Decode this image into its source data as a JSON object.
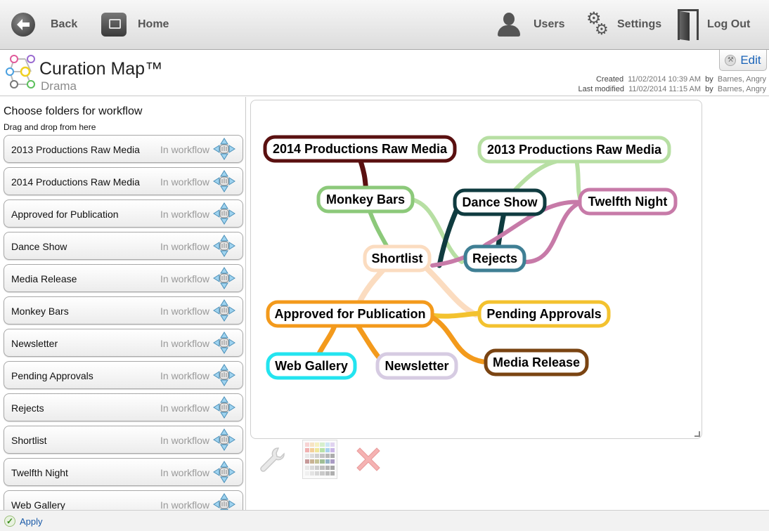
{
  "toolbar": {
    "back_label": "Back",
    "home_label": "Home",
    "users_label": "Users",
    "settings_label": "Settings",
    "logout_label": "Log Out"
  },
  "header": {
    "title": "Curation Map™",
    "subtitle": "Drama",
    "edit_label": "Edit",
    "created_label": "Created",
    "created_date": "11/02/2014 10:39 AM",
    "created_by_label": "by",
    "created_by": "Barnes, Angry",
    "modified_label": "Last modified",
    "modified_date": "11/02/2014 11:15 AM",
    "modified_by_label": "by",
    "modified_by": "Barnes, Angry"
  },
  "sidebar": {
    "heading": "Choose folders for workflow",
    "hint": "Drag and drop from here",
    "items": [
      {
        "name": "2013 Productions Raw Media",
        "status": "In workflow"
      },
      {
        "name": "2014 Productions Raw Media",
        "status": "In workflow"
      },
      {
        "name": "Approved for Publication",
        "status": "In workflow"
      },
      {
        "name": "Dance Show",
        "status": "In workflow"
      },
      {
        "name": "Media Release",
        "status": "In workflow"
      },
      {
        "name": "Monkey Bars",
        "status": "In workflow"
      },
      {
        "name": "Newsletter",
        "status": "In workflow"
      },
      {
        "name": "Pending Approvals",
        "status": "In workflow"
      },
      {
        "name": "Rejects",
        "status": "In workflow"
      },
      {
        "name": "Shortlist",
        "status": "In workflow"
      },
      {
        "name": "Twelfth Night",
        "status": "In workflow"
      },
      {
        "name": "Web Gallery",
        "status": "In workflow"
      }
    ]
  },
  "map": {
    "nodes": [
      {
        "id": "p2014",
        "label": "2014 Productions Raw Media",
        "color": "#5a1010"
      },
      {
        "id": "p2013",
        "label": "2013 Productions Raw Media",
        "color": "#b7dfa3"
      },
      {
        "id": "monkey",
        "label": "Monkey Bars",
        "color": "#8cc97a"
      },
      {
        "id": "dance",
        "label": "Dance Show",
        "color": "#0f3b3f"
      },
      {
        "id": "twelfth",
        "label": "Twelfth Night",
        "color": "#c77aa8"
      },
      {
        "id": "shortlist",
        "label": "Shortlist",
        "color": "#fbdcc0"
      },
      {
        "id": "rejects",
        "label": "Rejects",
        "color": "#3f7f94"
      },
      {
        "id": "approved",
        "label": "Approved for Publication",
        "color": "#f39a1c"
      },
      {
        "id": "pending",
        "label": "Pending Approvals",
        "color": "#f3c22f"
      },
      {
        "id": "webgallery",
        "label": "Web Gallery",
        "color": "#23e4ef"
      },
      {
        "id": "newsletter",
        "label": "Newsletter",
        "color": "#d6cbe2"
      },
      {
        "id": "mediarelease",
        "label": "Media Release",
        "color": "#7a4412"
      }
    ]
  },
  "tools": {
    "wrench": "wrench-icon",
    "palette": "color-palette-icon",
    "delete": "delete-x-icon"
  },
  "bottom": {
    "apply_label": "Apply"
  }
}
